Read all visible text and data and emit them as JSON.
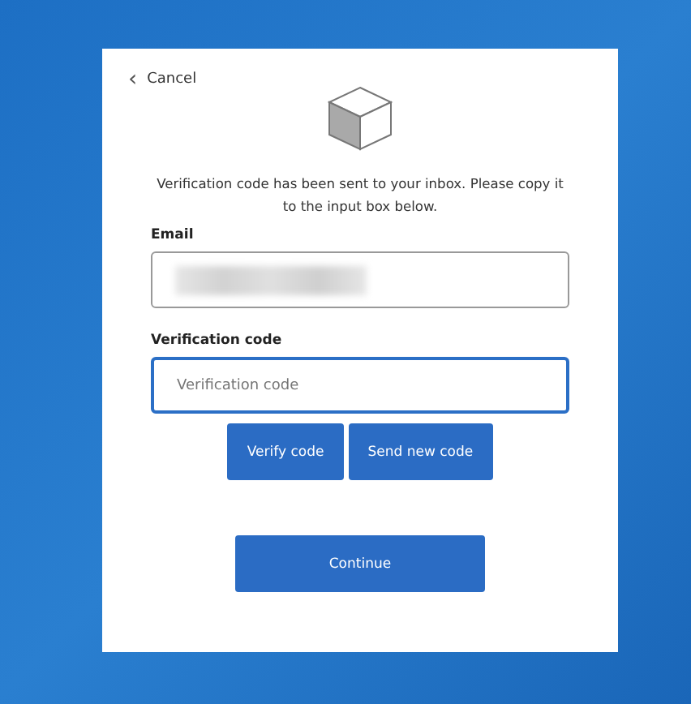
{
  "cancel": {
    "icon": "‹",
    "label": "Cancel"
  },
  "message": "Verification code has been sent to your inbox. Please copy it to the input box below.",
  "email": {
    "label": "Email",
    "value_blurred": true
  },
  "verification_code": {
    "label": "Verification code",
    "placeholder": "Verification code",
    "focused": true
  },
  "buttons": [
    {
      "label": "Verify code"
    },
    {
      "label": "Send new code"
    }
  ],
  "continue_button": {
    "label": "Continue"
  }
}
